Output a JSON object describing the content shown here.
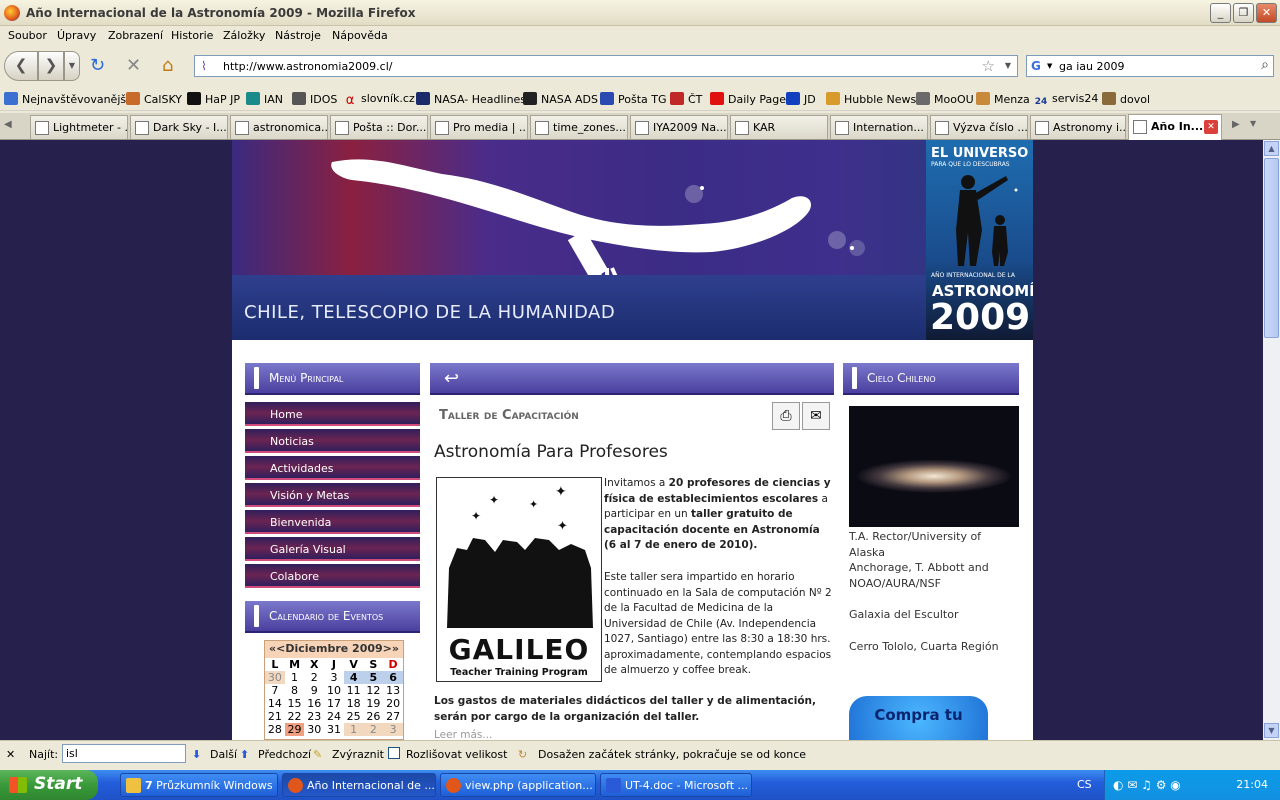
{
  "window": {
    "title": "Año Internacional de la Astronomía 2009 - Mozilla Firefox"
  },
  "menu": [
    "Soubor",
    "Úpravy",
    "Zobrazení",
    "Historie",
    "Záložky",
    "Nástroje",
    "Nápověda"
  ],
  "nav": {
    "url": "http://www.astronomia2009.cl/",
    "search_value": "ga iau 2009"
  },
  "bookmarks": [
    "Nejnavštěvovanější",
    "CalSKY",
    "HaP JP",
    "IAN",
    "IDOS",
    "slovník.cz",
    "NASA- Headlines",
    "NASA ADS",
    "Pošta TG",
    "ČT",
    "Daily Page",
    "JD",
    "Hubble News",
    "MooOU",
    "Menza",
    "servis24",
    "dovol"
  ],
  "bookmark_badges": {
    "ct_day": "24"
  },
  "tabs": [
    "Lightmeter - ...",
    "Dark Sky - I...",
    "astronomica...",
    "Pošta :: Dor...",
    "Pro media | ...",
    "time_zones...",
    "IYA2009 Na...",
    "KAR",
    "Internation...",
    "Výzva číslo ...",
    "Astronomy i...",
    "Año In..."
  ],
  "site": {
    "banner_title": "CHILE, TELESCOPIO DE LA HUMANIDAD",
    "promo": {
      "line1": "EL UNIVERSO",
      "line2": "PARA QUE LO DESCUBRAS",
      "line3": "AÑO INTERNACIONAL DE LA",
      "line4": "ASTRONOMÍA",
      "year": "2009"
    },
    "menu_title": "Menú Principal",
    "menu_items": [
      "Home",
      "Noticias",
      "Actividades",
      "Visión y Metas",
      "Bienvenida",
      "Galería Visual",
      "Colabore"
    ],
    "calendar_title": "Calendario de Eventos",
    "calendar": {
      "header": "«<Diciembre 2009>»",
      "days": [
        "L",
        "M",
        "X",
        "J",
        "V",
        "S",
        "D"
      ],
      "rows": [
        [
          "30",
          "1",
          "2",
          "3",
          "4",
          "5",
          "6"
        ],
        [
          "7",
          "8",
          "9",
          "10",
          "11",
          "12",
          "13"
        ],
        [
          "14",
          "15",
          "16",
          "17",
          "18",
          "19",
          "20"
        ],
        [
          "21",
          "22",
          "23",
          "24",
          "25",
          "26",
          "27"
        ],
        [
          "28",
          "29",
          "30",
          "31",
          "1",
          "2",
          "3"
        ]
      ]
    },
    "section_title": "Taller de Capacitación",
    "article_title": "Astronomía Para Profesores",
    "galileo": {
      "title": "GALILEO",
      "subtitle": "Teacher Training Program"
    },
    "para1": {
      "a": "Invitamos a ",
      "b": "20 profesores de ciencias y física de establecimientos escolares",
      "c": " a participar en un ",
      "d": "taller gratuito de capacitación docente en Astronomía (6 al 7 de enero de 2010)."
    },
    "para2": "Este taller sera impartido en horario continuado en la Sala de computación Nº 2 de la Facultad de Medicina de la Universidad de Chile (Av. Independencia 1027, Santiago) entre las 8:30 a 18:30 hrs. aproximadamente, contemplando espacios de almuerzo y coffee break.",
    "para3": "Los gastos de materiales didácticos del taller y de alimentación, serán por cargo de la organización del taller.",
    "read_more": "Leer más...",
    "sky_title": "Cielo Chileno",
    "sky_caption1": "T.A. Rector/University of Alaska",
    "sky_caption2": "Anchorage, T. Abbott and NOAO/AURA/NSF",
    "sky_caption3": "Galaxia del Escultor",
    "sky_caption4": "Cerro Tololo, Cuarta Región",
    "buy_label": "Compra tu"
  },
  "findbar": {
    "label": "Najít:",
    "value": "isl",
    "next": "Další",
    "prev": "Předchozí",
    "highlight": "Zvýraznit",
    "match_case": "Rozlišovat velikost",
    "status": "Dosažen začátek stránky, pokračuje se od konce"
  },
  "taskbar": {
    "start": "Start",
    "items": [
      "Průzkumník Windows",
      "Año Internacional de ...",
      "view.php (application...",
      "UT-4.doc - Microsoft ..."
    ],
    "explorer_count": "7",
    "lang": "CS",
    "clock": "21:04"
  }
}
